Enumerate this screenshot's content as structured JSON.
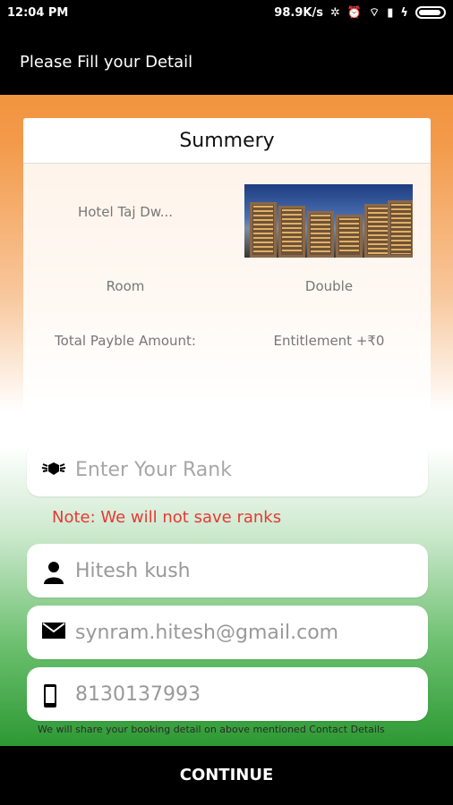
{
  "status_bar": {
    "time": "12:04 PM",
    "speed": "98.9K/s"
  },
  "app_bar": {
    "title": "Please Fill your Detail"
  },
  "summary": {
    "title": "Summery",
    "hotel_name": "Hotel Taj Dw...",
    "room_label": "Room",
    "room_value": "Double",
    "amount_label": "Total Payble Amount:",
    "amount_value": "Entitlement +₹0"
  },
  "form": {
    "rank_placeholder": "Enter Your Rank",
    "note": "Note: We will not save ranks",
    "name_value": "Hitesh kush",
    "email_value": "synram.hitesh@gmail.com",
    "phone_value": "8130137993",
    "share_note": "We will share your booking detail on above mentioned Contact Details"
  },
  "actions": {
    "continue_label": "CONTINUE"
  }
}
